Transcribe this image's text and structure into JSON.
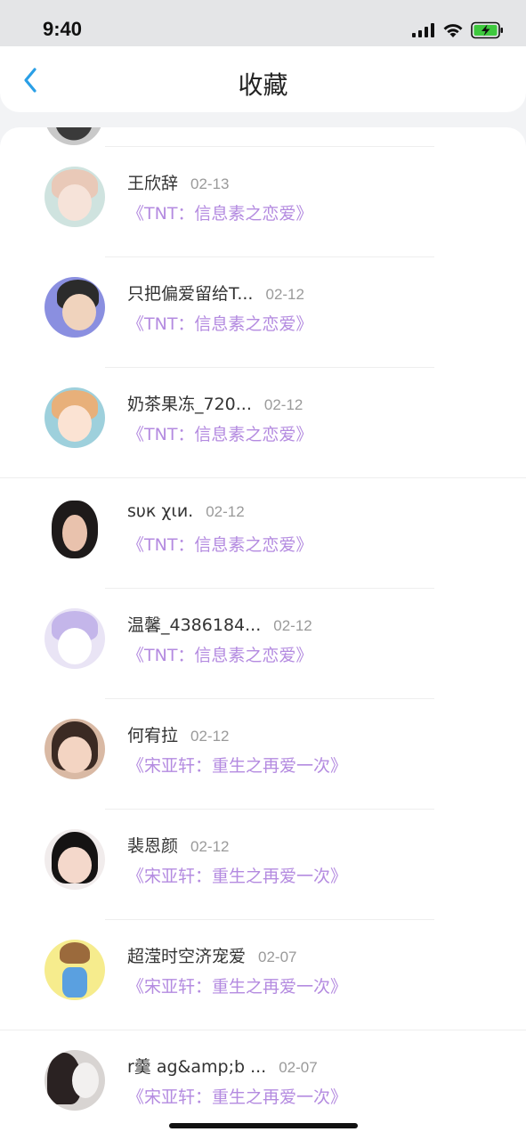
{
  "status_bar": {
    "time": "9:40"
  },
  "nav": {
    "title": "收藏"
  },
  "rows": [
    {
      "name": "王欣辞",
      "date": "02-13",
      "book": "《TNT：信息素之恋爱》"
    },
    {
      "name": "只把偏爱留给T...",
      "date": "02-12",
      "book": "《TNT：信息素之恋爱》"
    },
    {
      "name": "奶茶果冻_720...",
      "date": "02-12",
      "book": "《TNT：信息素之恋爱》"
    },
    {
      "name": "sυк χιи.",
      "date": "02-12",
      "book": "《TNT：信息素之恋爱》"
    },
    {
      "name": "温馨_4386184...",
      "date": "02-12",
      "book": "《TNT：信息素之恋爱》"
    },
    {
      "name": "何宥拉",
      "date": "02-12",
      "book": "《宋亚轩：重生之再爱一次》"
    },
    {
      "name": "裴恩颜",
      "date": "02-12",
      "book": "《宋亚轩：重生之再爱一次》"
    },
    {
      "name": "超滢时空济宠爱",
      "date": "02-07",
      "book": "《宋亚轩：重生之再爱一次》"
    },
    {
      "name": "r羹 ag&amp;b ...",
      "date": "02-07",
      "book": "《宋亚轩：重生之再爱一次》"
    }
  ]
}
